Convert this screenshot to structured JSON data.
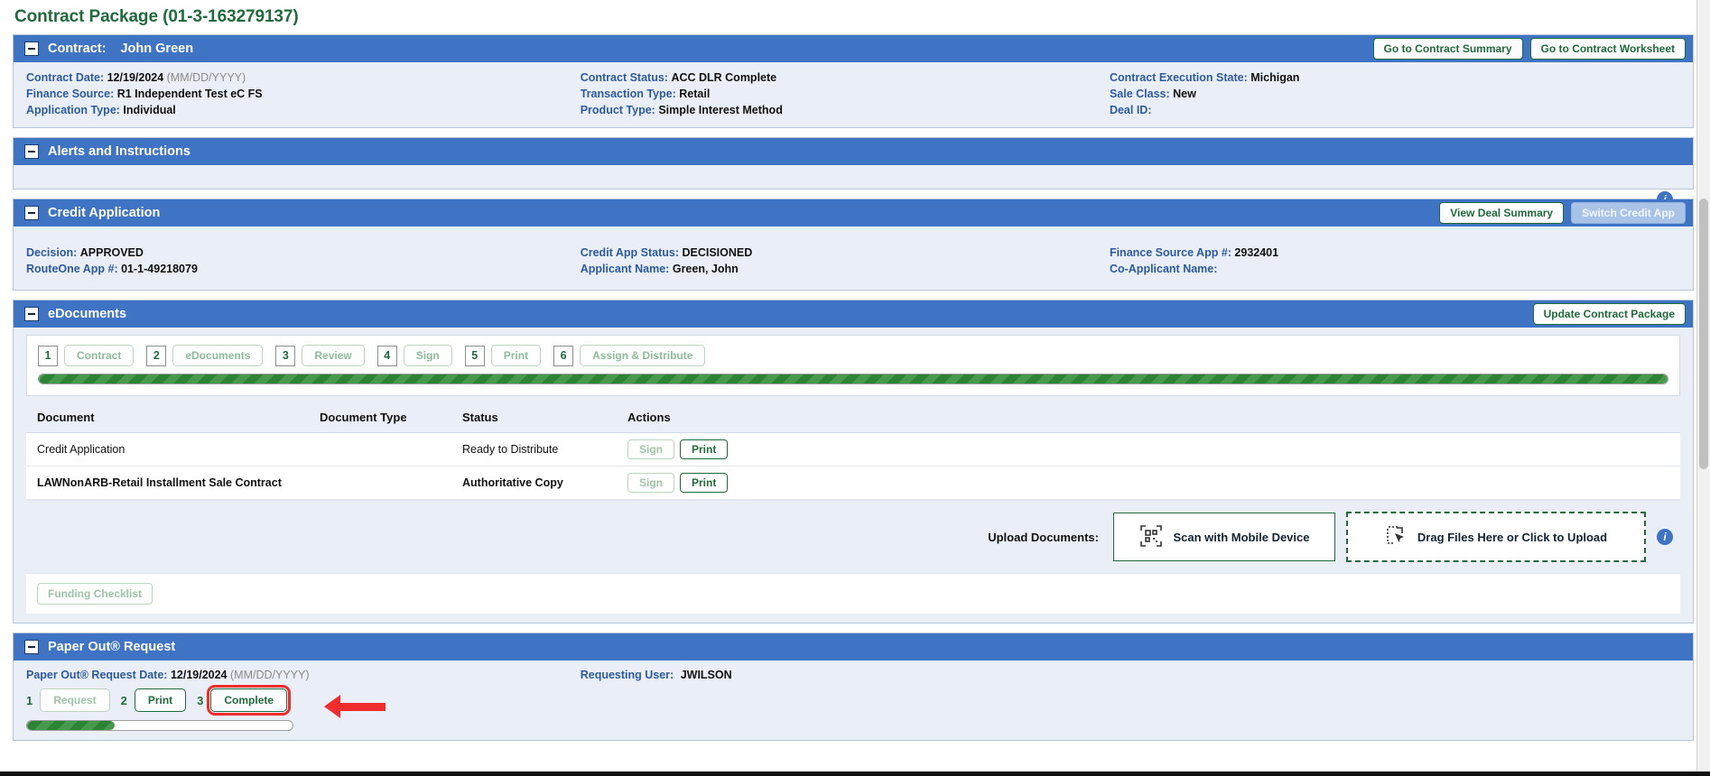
{
  "page": {
    "title": "Contract Package (01-3-163279137)"
  },
  "contract_panel": {
    "title": "Contract:",
    "subject": "John Green",
    "buttons": {
      "summary": "Go to Contract Summary",
      "worksheet": "Go to Contract Worksheet"
    },
    "fields": {
      "contract_date_label": "Contract Date:",
      "contract_date_value": "12/19/2024",
      "contract_date_hint": "(MM/DD/YYYY)",
      "finance_source_label": "Finance Source:",
      "finance_source_value": "R1 Independent Test eC FS",
      "application_type_label": "Application Type:",
      "application_type_value": "Individual",
      "contract_status_label": "Contract Status:",
      "contract_status_value": "ACC DLR Complete",
      "transaction_type_label": "Transaction Type:",
      "transaction_type_value": "Retail",
      "product_type_label": "Product Type:",
      "product_type_value": "Simple Interest Method",
      "execution_state_label": "Contract Execution State:",
      "execution_state_value": "Michigan",
      "sale_class_label": "Sale Class:",
      "sale_class_value": "New",
      "deal_id_label": "Deal ID:",
      "deal_id_value": ""
    }
  },
  "alerts_panel": {
    "title": "Alerts and Instructions"
  },
  "credit_panel": {
    "title": "Credit Application",
    "buttons": {
      "view_deal_summary": "View Deal Summary",
      "switch_credit_app": "Switch Credit App"
    },
    "info_icon": "i",
    "fields": {
      "decision_label": "Decision:",
      "decision_value": "APPROVED",
      "routeone_label": "RouteOne App #:",
      "routeone_value": "01-1-49218079",
      "credit_status_label": "Credit App Status:",
      "credit_status_value": "DECISIONED",
      "applicant_label": "Applicant Name:",
      "applicant_value": "Green, John",
      "fs_app_label": "Finance Source App #:",
      "fs_app_value": "2932401",
      "coapplicant_label": "Co-Applicant Name:",
      "coapplicant_value": ""
    }
  },
  "edocs_panel": {
    "title": "eDocuments",
    "update_button": "Update Contract Package",
    "wizard": {
      "steps": [
        {
          "num": "1",
          "label": "Contract"
        },
        {
          "num": "2",
          "label": "eDocuments"
        },
        {
          "num": "3",
          "label": "Review"
        },
        {
          "num": "4",
          "label": "Sign"
        },
        {
          "num": "5",
          "label": "Print"
        },
        {
          "num": "6",
          "label": "Assign & Distribute"
        }
      ],
      "progress_percent": 100
    },
    "table": {
      "headers": [
        "Document",
        "Document Type",
        "Status",
        "Actions"
      ],
      "rows": [
        {
          "document": "Credit Application",
          "document_type": "",
          "status": "Ready to Distribute",
          "sign": "Sign",
          "print": "Print",
          "bold": false
        },
        {
          "document": "LAWNonARB-Retail Installment Sale Contract",
          "document_type": "",
          "status": "Authoritative Copy",
          "sign": "Sign",
          "print": "Print",
          "bold": true
        }
      ]
    },
    "upload": {
      "label": "Upload Documents:",
      "scan_text": "Scan with Mobile Device",
      "scan_icon": "qr-scan-icon",
      "drop_text": "Drag Files Here or  Click to Upload",
      "drop_icon": "file-cursor-icon",
      "info_icon": "i"
    },
    "funding_checklist": "Funding Checklist"
  },
  "paperout_panel": {
    "title": "Paper Out® Request",
    "fields": {
      "request_date_label": "Paper Out® Request Date:",
      "request_date_value": "12/19/2024",
      "request_date_hint": "(MM/DD/YYYY)",
      "requesting_user_label": "Requesting User:",
      "requesting_user_value": "JWILSON"
    },
    "wizard": {
      "steps": [
        {
          "num": "1",
          "label": "Request",
          "state": "done"
        },
        {
          "num": "2",
          "label": "Print",
          "state": "active"
        },
        {
          "num": "3",
          "label": "Complete",
          "state": "highlighted"
        }
      ],
      "progress_percent": 33
    }
  },
  "colors": {
    "panel_header": "#3f74c4",
    "panel_body": "#eaeff7",
    "accent_green": "#1f6b3b",
    "progress_green": "#2e8b36",
    "highlight_red": "#ef2d2d",
    "label_blue": "#2d5a9e"
  }
}
